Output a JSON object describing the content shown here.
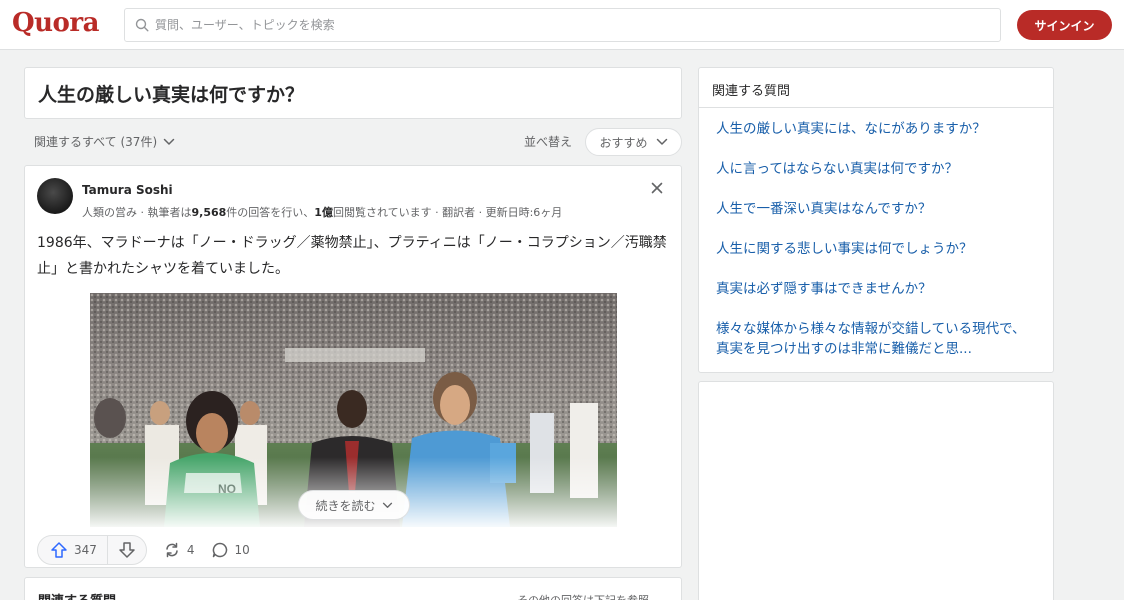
{
  "header": {
    "logo": "Quora",
    "search_placeholder": "質問、ユーザー、トピックを検索",
    "signin_label": "サインイン"
  },
  "question": {
    "title": "人生の厳しい真実は何ですか？"
  },
  "filter": {
    "related_all": "関連するすべて (37件)",
    "sort_label": "並べ替え",
    "sort_value": "おすすめ"
  },
  "answer": {
    "author": "Tamura Soshi",
    "credential_prefix": "人類の営み · 執筆者は",
    "answer_count": "9,568",
    "credential_mid": "件の回答を行い、",
    "view_count": "1億",
    "credential_suffix": "回閲覧されています · 翻訳者 · 更新日時:6ヶ月",
    "text": "1986年、マラドーナは「ノー・ドラッグ／薬物禁止」、プラティニは「ノー・コラプション／汚職禁止」と書かれたシャツを着ていました。",
    "read_more": "続きを読む",
    "upvotes": "347",
    "shares": "4",
    "comments": "10",
    "shirt_text": "NO"
  },
  "bottom_card": {
    "title": "関連する質問",
    "right_text": "その他の回答は下記を参照"
  },
  "sidebar": {
    "title": "関連する質問",
    "items": [
      "人生の厳しい真実には、なにがありますか？",
      "人に言ってはならない真実は何ですか？",
      "人生で一番深い真実はなんですか？",
      "人生に関する悲しい事実は何でしょうか？",
      "真実は必ず隠す事はできませんか？",
      "様々な媒体から様々な情報が交錯している現代で、真実を見つけ出すのは非常に難儀だと思..."
    ]
  },
  "colors": {
    "brand": "#b92b27",
    "link": "#195faa",
    "upvote": "#2e69ff"
  }
}
